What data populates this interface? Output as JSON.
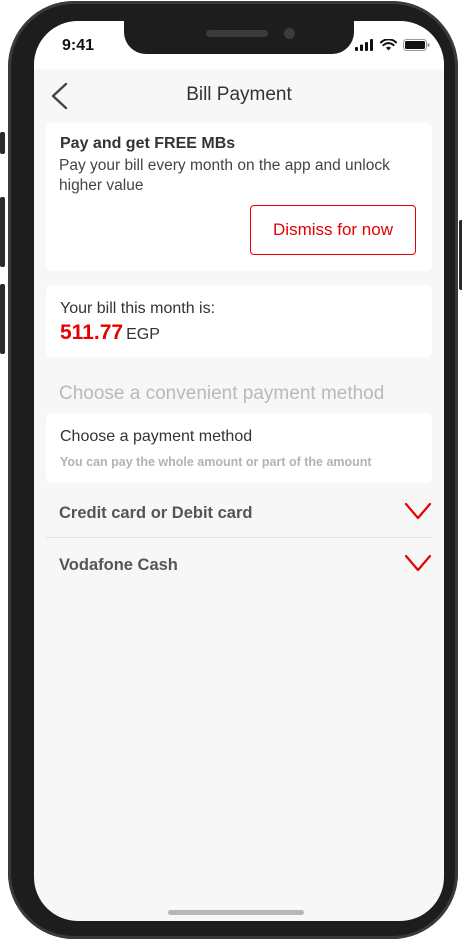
{
  "status_bar": {
    "time": "9:41",
    "icons": [
      "signal-icon",
      "wifi-icon",
      "battery-icon"
    ]
  },
  "header": {
    "title": "Bill Payment",
    "back_icon": "chevron-left-icon"
  },
  "promo": {
    "title": "Pay and get FREE MBs",
    "text": "Pay your bill every month on the app and unlock higher value",
    "dismiss_label": "Dismiss for now"
  },
  "bill": {
    "label": "Your bill this month is:",
    "amount": "511.77",
    "currency": "EGP"
  },
  "payment": {
    "section_title": "Choose a convenient payment method",
    "card_title": "Choose a payment method",
    "card_subtitle": "You can pay the whole amount or part of the amount",
    "options": [
      {
        "label": "Credit card or Debit card",
        "icon": "chevron-down-icon"
      },
      {
        "label": "Vodafone Cash",
        "icon": "chevron-down-icon"
      }
    ]
  },
  "colors": {
    "accent": "#e60000",
    "background": "#f7f7f7",
    "card": "#ffffff",
    "muted_text": "#b9b9b9"
  }
}
